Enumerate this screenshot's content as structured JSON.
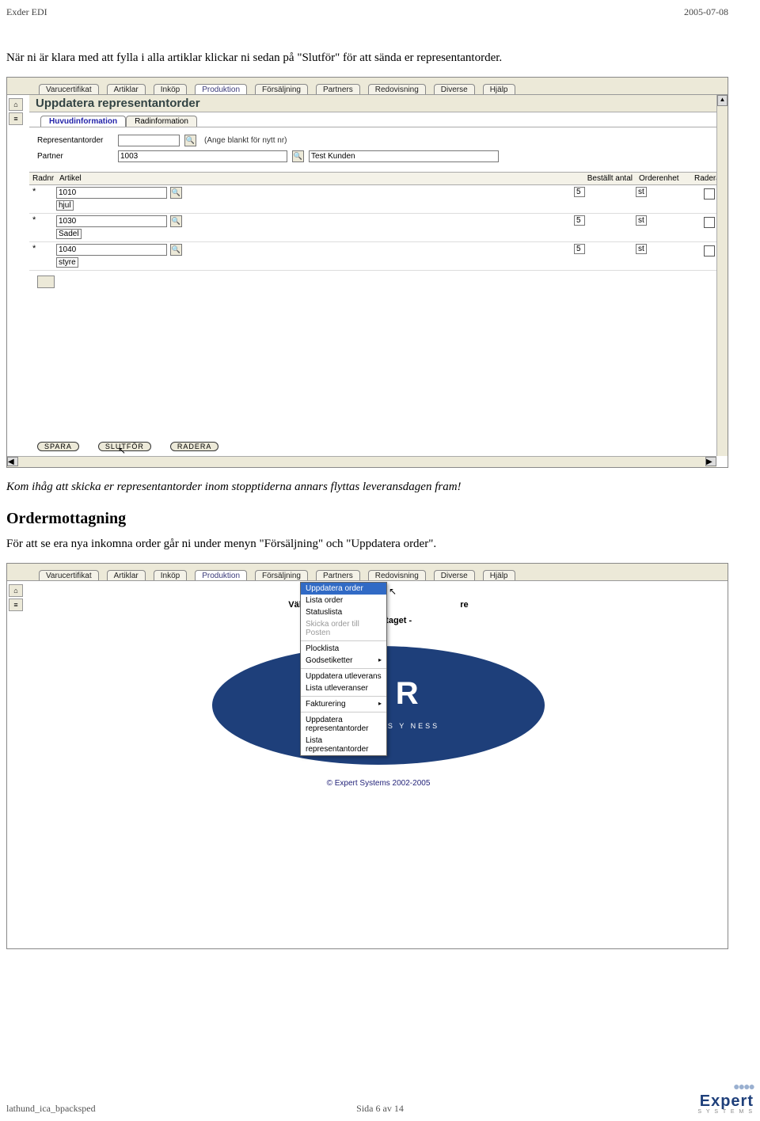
{
  "header": {
    "left": "Exder EDI",
    "right": "2005-07-08"
  },
  "para1": "När ni är klara med att fylla i alla artiklar klickar ni sedan på \"Slutför\" för att sända er representantorder.",
  "para2": "Kom ihåg att skicka er representantorder inom stopptiderna annars flyttas leveransdagen fram!",
  "h2": "Ordermottagning",
  "para3": "För att se era nya inkomna order går ni under menyn \"Försäljning\" och \"Uppdatera order\".",
  "topTabs": [
    "Varucertifikat",
    "Artiklar",
    "Inköp",
    "Produktion",
    "Försäljning",
    "Partners",
    "Redovisning",
    "Diverse",
    "Hjälp"
  ],
  "ss1": {
    "title": "Uppdatera representantorder",
    "subtabs": [
      "Huvudinformation",
      "Radinformation"
    ],
    "fields": {
      "rep_label": "Representantorder",
      "rep_hint": "(Ange blankt för nytt nr)",
      "partner_label": "Partner",
      "partner_val": "1003",
      "partner_name": "Test Kunden"
    },
    "cols": {
      "r": "Radnr",
      "a": "Artikel",
      "b": "Beställt antal",
      "o": "Orderenhet",
      "d": "Radera"
    },
    "rows": [
      {
        "art": "1010",
        "desc": "hjul",
        "qty": "5",
        "unit": "st"
      },
      {
        "art": "1030",
        "desc": "Sadel",
        "qty": "5",
        "unit": "st"
      },
      {
        "art": "1040",
        "desc": "styre",
        "qty": "5",
        "unit": "st"
      }
    ],
    "buttons": {
      "save": "SPARA",
      "done": "SLUTFÖR",
      "del": "RADERA"
    }
  },
  "ss2": {
    "welcome": "Välkommen till Exde",
    "welcome2": "re",
    "demo": "Demoföretaget -",
    "brand": "EX   R",
    "tag": "EXDER MAKES Y            NESS",
    "copyright": "© Expert Systems 2002-2005",
    "menu": [
      {
        "t": "Uppdatera order",
        "hl": true
      },
      {
        "t": "Lista order"
      },
      {
        "t": "Statuslista"
      },
      {
        "t": "Skicka order till Posten",
        "dis": true
      },
      {
        "sep": true
      },
      {
        "t": "Plocklista"
      },
      {
        "t": "Godsetiketter",
        "arr": true
      },
      {
        "sep": true
      },
      {
        "t": "Uppdatera utleverans"
      },
      {
        "t": "Lista utleveranser"
      },
      {
        "sep": true
      },
      {
        "t": "Fakturering",
        "arr": true
      },
      {
        "sep": true
      },
      {
        "t": "Uppdatera representantorder"
      },
      {
        "t": "Lista representantorder"
      }
    ]
  },
  "footer": {
    "left": "lathund_ica_bpacksped",
    "mid": "Sida 6 av 14",
    "logo_big": "Expert",
    "logo_sml": "S Y S T E M S"
  }
}
